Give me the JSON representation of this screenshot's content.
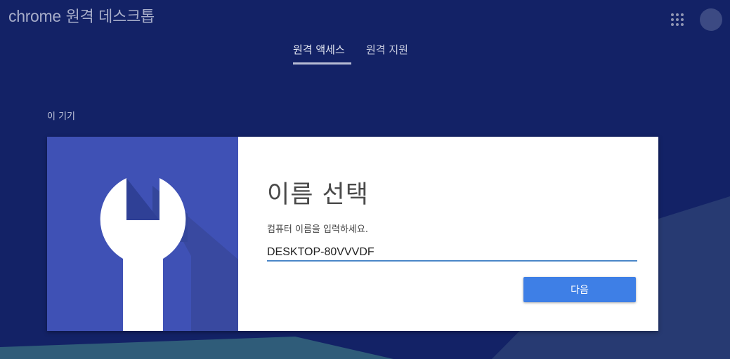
{
  "app": {
    "brand": "chrome",
    "title": "원격 데스크톱"
  },
  "header": {
    "apps_icon": "apps-grid-icon",
    "avatar_icon": "account-avatar"
  },
  "tabs": [
    {
      "label": "원격 액세스",
      "selected": true
    },
    {
      "label": "원격 지원",
      "selected": false
    }
  ],
  "section": {
    "label": "이 기기"
  },
  "setup_card": {
    "art_icon": "wrench-icon",
    "title": "이름 선택",
    "prompt": "컴퓨터 이름을 입력하세요.",
    "computer_name": "DESKTOP-80VVVDF",
    "next_label": "다음"
  },
  "colors": {
    "background": "#132266",
    "art_panel": "#3f51b5",
    "primary_button": "#3e7fe6",
    "input_underline": "#4a86c8"
  }
}
